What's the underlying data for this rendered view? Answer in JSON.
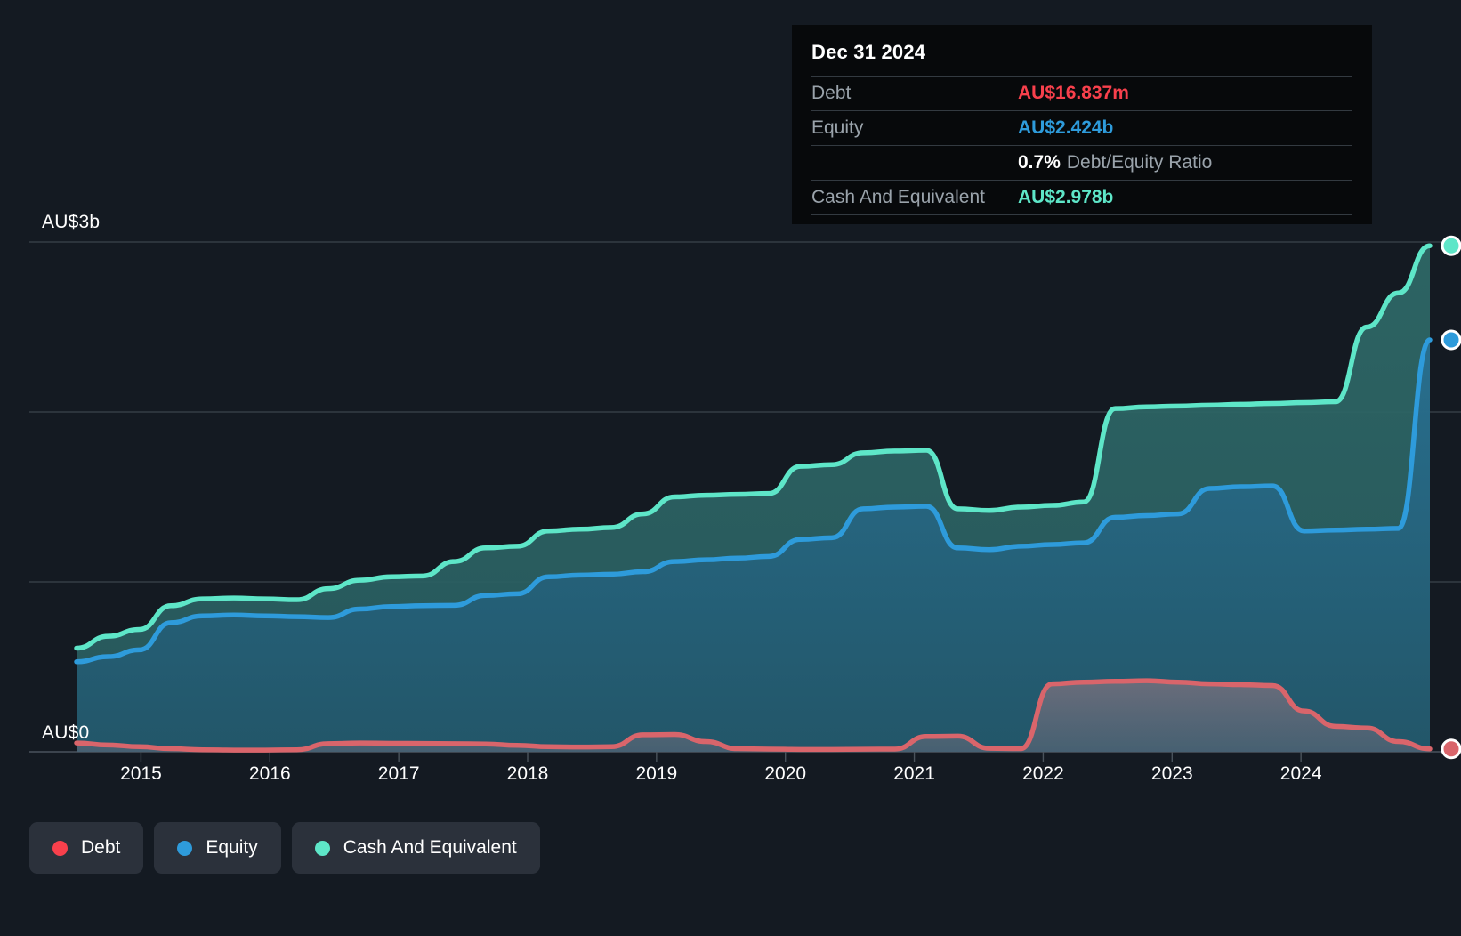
{
  "chart_data": {
    "type": "area",
    "title": "",
    "xlabel": "",
    "ylabel": "",
    "currency": "AU$",
    "grid": true,
    "legend_position": "bottom-left",
    "ylim": [
      0,
      3000000000
    ],
    "y_ticks": [
      {
        "value": 3000000000,
        "label": "AU$3b"
      },
      {
        "value": 2000000000,
        "label": ""
      },
      {
        "value": 1000000000,
        "label": ""
      },
      {
        "value": 0,
        "label": "AU$0"
      }
    ],
    "x_ticks": [
      "2015",
      "2016",
      "2017",
      "2018",
      "2019",
      "2020",
      "2021",
      "2022",
      "2023",
      "2024"
    ],
    "x_range": [
      "2014-06-30",
      "2024-12-31"
    ],
    "series": [
      {
        "name": "Debt",
        "color": "#d9656b",
        "fill": "rgba(120,110,125,0.55)",
        "unit": "AU$",
        "values": [
          0.052,
          0.04,
          0.03,
          0.018,
          0.012,
          0.01,
          0.01,
          0.012,
          0.048,
          0.052,
          0.05,
          0.049,
          0.048,
          0.046,
          0.038,
          0.03,
          0.028,
          0.03,
          0.1,
          0.102,
          0.06,
          0.018,
          0.016,
          0.014,
          0.014,
          0.015,
          0.016,
          0.09,
          0.092,
          0.02,
          0.018,
          0.4,
          0.41,
          0.415,
          0.418,
          0.41,
          0.4,
          0.395,
          0.39,
          0.24,
          0.15,
          0.14,
          0.06,
          0.017
        ]
      },
      {
        "name": "Equity",
        "color": "#2e9bdb",
        "fill": "rgba(38,100,130,0.75)",
        "unit": "AU$",
        "values": [
          0.53,
          0.56,
          0.6,
          0.76,
          0.8,
          0.805,
          0.8,
          0.795,
          0.79,
          0.84,
          0.855,
          0.86,
          0.862,
          0.92,
          0.93,
          1.03,
          1.04,
          1.045,
          1.06,
          1.12,
          1.13,
          1.14,
          1.15,
          1.25,
          1.26,
          1.43,
          1.44,
          1.445,
          1.2,
          1.19,
          1.21,
          1.22,
          1.23,
          1.38,
          1.39,
          1.4,
          1.55,
          1.56,
          1.565,
          1.3,
          1.305,
          1.31,
          1.315,
          2.424
        ]
      },
      {
        "name": "Cash And Equivalent",
        "color": "#5ee6c8",
        "fill": "rgba(46,104,104,0.70)",
        "unit": "AU$",
        "values": [
          0.61,
          0.68,
          0.72,
          0.86,
          0.9,
          0.905,
          0.9,
          0.895,
          0.96,
          1.01,
          1.03,
          1.035,
          1.12,
          1.2,
          1.21,
          1.3,
          1.31,
          1.32,
          1.4,
          1.5,
          1.51,
          1.515,
          1.52,
          1.68,
          1.69,
          1.76,
          1.77,
          1.775,
          1.43,
          1.42,
          1.44,
          1.45,
          1.47,
          2.02,
          2.03,
          2.035,
          2.04,
          2.045,
          2.05,
          2.055,
          2.06,
          2.5,
          2.7,
          2.978
        ]
      }
    ]
  },
  "axis": {
    "y_top_label": "AU$3b",
    "y_zero_label": "AU$0"
  },
  "tooltip": {
    "date": "Dec 31 2024",
    "rows": [
      {
        "key": "Debt",
        "value": "AU$16.837m",
        "kind": "debt"
      },
      {
        "key": "Equity",
        "value": "AU$2.424b",
        "kind": "equity"
      }
    ],
    "ratio_value": "0.7%",
    "ratio_label": "Debt/Equity Ratio",
    "cash_key": "Cash And Equivalent",
    "cash_value": "AU$2.978b"
  },
  "legend": {
    "items": [
      {
        "label": "Debt",
        "color": "#f8404c",
        "icon": "legend-dot-icon"
      },
      {
        "label": "Equity",
        "color": "#2e9bdb",
        "icon": "legend-dot-icon"
      },
      {
        "label": "Cash And Equivalent",
        "color": "#5ee6c8",
        "icon": "legend-dot-icon"
      }
    ]
  },
  "colors": {
    "background": "#141a22",
    "gridline": "#3a434c",
    "tooltip_background": "#07090b",
    "debt": "#f8404c",
    "equity": "#2e9bdb",
    "cash": "#5ee6c8"
  }
}
